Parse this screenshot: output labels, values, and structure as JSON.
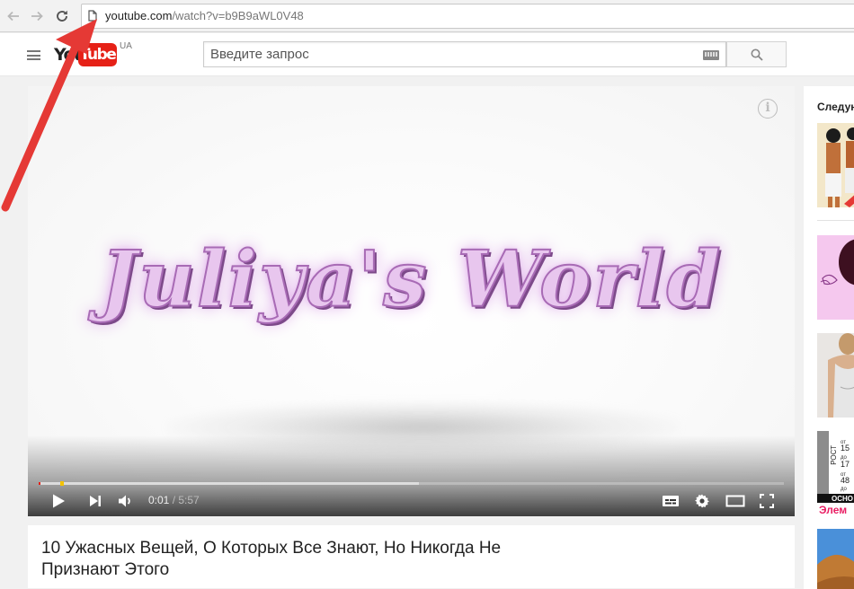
{
  "browser": {
    "url_host": "youtube.com",
    "url_path": "/watch?v=b9B9aWL0V48"
  },
  "header": {
    "logo_you": "You",
    "logo_tube": "Tube",
    "logo_region": "UA",
    "search_placeholder": "Введите запрос"
  },
  "player": {
    "video_art_text": "Juliya's World",
    "current_time": "0:01",
    "time_separator": " / ",
    "duration": "5:57",
    "progress_played_fraction": 0.003,
    "progress_loaded_fraction": 0.51
  },
  "video": {
    "title": "10 Ужасных Вещей, О Которых Все Знают, Но Никогда Не Признают Этого"
  },
  "sidebar": {
    "heading": "Следую",
    "thumb4_lines": [
      "РОСТ",
      "от",
      "15",
      "до",
      "17",
      "от",
      "48",
      "до",
      "ОСНО",
      "Элем"
    ]
  },
  "colors": {
    "youtube_red": "#e62117",
    "annotation_red": "#e53935",
    "art_fill": "#e8c6ee",
    "art_stroke": "#a86bb5"
  },
  "icons": {
    "back": "arrow-left-icon",
    "forward": "arrow-right-icon",
    "reload": "reload-icon",
    "page": "page-icon",
    "menu": "hamburger-menu-icon",
    "keyboard": "keyboard-icon",
    "search": "magnifier-icon",
    "info": "info-icon",
    "play": "play-icon",
    "next": "next-icon",
    "volume": "volume-icon",
    "subtitles": "subtitles-icon",
    "settings": "gear-icon",
    "theater": "theater-mode-icon",
    "fullscreen": "fullscreen-icon"
  }
}
